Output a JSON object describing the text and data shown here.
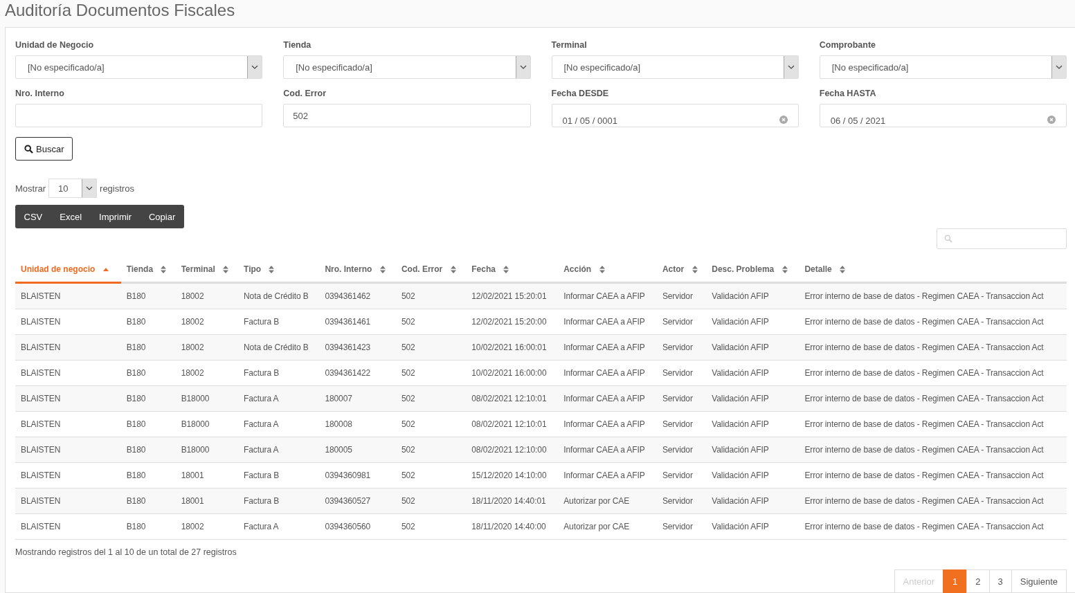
{
  "title": "Auditoría Documentos Fiscales",
  "filters": [
    {
      "kind": "select",
      "label": "Unidad de Negocio",
      "value": "[No especificado/a]"
    },
    {
      "kind": "select",
      "label": "Tienda",
      "value": "[No especificado/a]"
    },
    {
      "kind": "select",
      "label": "Terminal",
      "value": "[No especificado/a]"
    },
    {
      "kind": "select",
      "label": "Comprobante",
      "value": "[No especificado/a]"
    },
    {
      "kind": "text",
      "label": "Nro. Interno"
    },
    {
      "kind": "text",
      "label": "Cod. Error",
      "value": "502"
    },
    {
      "kind": "date",
      "label": "Fecha DESDE",
      "value": "01 / 05 / 0001"
    },
    {
      "kind": "date",
      "label": "Fecha HASTA",
      "value": "06 / 05 / 2021"
    }
  ],
  "search_button": "Buscar",
  "length": {
    "prefix": "Mostrar",
    "value": "10",
    "suffix": "registros"
  },
  "export_buttons": [
    "CSV",
    "Excel",
    "Imprimir",
    "Copiar"
  ],
  "table": {
    "columns": [
      {
        "label": "Unidad de negocio",
        "selected": true
      },
      {
        "label": "Tienda",
        "selected": false
      },
      {
        "label": "Terminal",
        "selected": false
      },
      {
        "label": "Tipo",
        "selected": false
      },
      {
        "label": "Nro. Interno",
        "selected": false
      },
      {
        "label": "Cod. Error",
        "selected": false
      },
      {
        "label": "Fecha",
        "selected": false
      },
      {
        "label": "Acción",
        "selected": false
      },
      {
        "label": "Actor",
        "selected": false
      },
      {
        "label": "Desc. Problema",
        "selected": false
      },
      {
        "label": "Detalle",
        "selected": false
      }
    ],
    "rows": [
      [
        "BLAISTEN",
        "B180",
        "18002",
        "Nota de Crédito B",
        "0394361462",
        "502",
        "12/02/2021 15:20:01",
        "Informar CAEA a AFIP",
        "Servidor",
        "Validación AFIP",
        "Error interno de base de datos - Regimen CAEA - Transaccion Act"
      ],
      [
        "BLAISTEN",
        "B180",
        "18002",
        "Factura B",
        "0394361461",
        "502",
        "12/02/2021 15:20:00",
        "Informar CAEA a AFIP",
        "Servidor",
        "Validación AFIP",
        "Error interno de base de datos - Regimen CAEA - Transaccion Act"
      ],
      [
        "BLAISTEN",
        "B180",
        "18002",
        "Nota de Crédito B",
        "0394361423",
        "502",
        "10/02/2021 16:00:01",
        "Informar CAEA a AFIP",
        "Servidor",
        "Validación AFIP",
        "Error interno de base de datos - Regimen CAEA - Transaccion Act"
      ],
      [
        "BLAISTEN",
        "B180",
        "18002",
        "Factura B",
        "0394361422",
        "502",
        "10/02/2021 16:00:00",
        "Informar CAEA a AFIP",
        "Servidor",
        "Validación AFIP",
        "Error interno de base de datos - Regimen CAEA - Transaccion Act"
      ],
      [
        "BLAISTEN",
        "B180",
        "B18000",
        "Factura A",
        "180007",
        "502",
        "08/02/2021 12:10:01",
        "Informar CAEA a AFIP",
        "Servidor",
        "Validación AFIP",
        "Error interno de base de datos - Regimen CAEA - Transaccion Act"
      ],
      [
        "BLAISTEN",
        "B180",
        "B18000",
        "Factura A",
        "180008",
        "502",
        "08/02/2021 12:10:01",
        "Informar CAEA a AFIP",
        "Servidor",
        "Validación AFIP",
        "Error interno de base de datos - Regimen CAEA - Transaccion Act"
      ],
      [
        "BLAISTEN",
        "B180",
        "B18000",
        "Factura A",
        "180005",
        "502",
        "08/02/2021 12:10:00",
        "Informar CAEA a AFIP",
        "Servidor",
        "Validación AFIP",
        "Error interno de base de datos - Regimen CAEA - Transaccion Act"
      ],
      [
        "BLAISTEN",
        "B180",
        "18001",
        "Factura B",
        "0394360981",
        "502",
        "15/12/2020 14:10:00",
        "Informar CAEA a AFIP",
        "Servidor",
        "Validación AFIP",
        "Error interno de base de datos - Regimen CAEA - Transaccion Act"
      ],
      [
        "BLAISTEN",
        "B180",
        "18001",
        "Factura B",
        "0394360527",
        "502",
        "18/11/2020 14:40:01",
        "Autorizar por CAE",
        "Servidor",
        "Validación AFIP",
        "Error interno de base de datos - Regimen CAEA - Transaccion Act"
      ],
      [
        "BLAISTEN",
        "B180",
        "18002",
        "Factura A",
        "0394360560",
        "502",
        "18/11/2020 14:40:00",
        "Autorizar por CAE",
        "Servidor",
        "Validación AFIP",
        "Error interno de base de datos - Regimen CAEA - Transaccion Act"
      ]
    ]
  },
  "info": "Mostrando registros del 1 al 10 de un total de 27 registros",
  "pagination": [
    {
      "label": "Anterior",
      "disabled": true,
      "selected": false
    },
    {
      "label": "1",
      "disabled": false,
      "selected": true
    },
    {
      "label": "2",
      "disabled": false,
      "selected": false
    },
    {
      "label": "3",
      "disabled": false,
      "selected": false
    },
    {
      "label": "Siguiente",
      "disabled": false,
      "selected": false
    }
  ]
}
